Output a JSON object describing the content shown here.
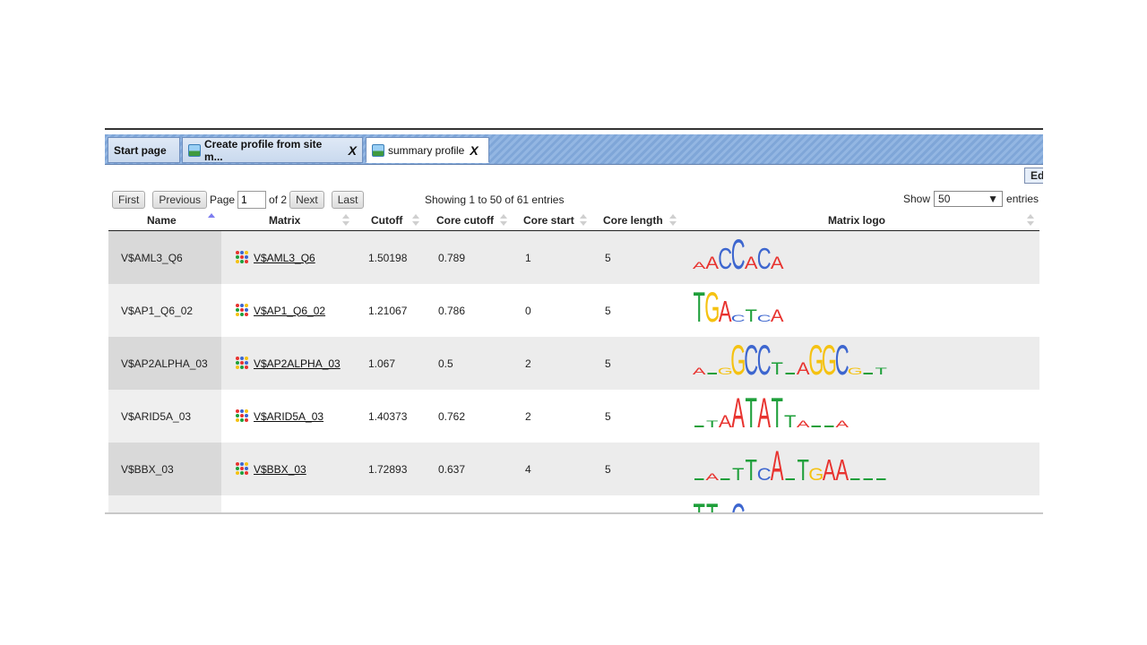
{
  "tabs": [
    {
      "label": "Start page",
      "has_icon": false,
      "closable": false
    },
    {
      "label": "Create profile from site m...",
      "has_icon": true,
      "closable": true
    },
    {
      "label": "summary profile",
      "has_icon": true,
      "closable": true,
      "active": true
    }
  ],
  "close_glyph": "X",
  "edit_button": "Ed",
  "pager": {
    "first": "First",
    "previous": "Previous",
    "page_label": "Page",
    "page_value": "1",
    "of_label": "of 2",
    "next": "Next",
    "last": "Last"
  },
  "info": "Showing 1 to 50 of 61 entries",
  "show": {
    "label": "Show",
    "value": "50",
    "suffix": "entries"
  },
  "columns": {
    "name": "Name",
    "matrix": "Matrix",
    "cutoff": "Cutoff",
    "core_cutoff": "Core cutoff",
    "core_start": "Core start",
    "core_length": "Core length",
    "matrix_logo": "Matrix logo"
  },
  "rows": [
    {
      "name": "V$AML3_Q6",
      "matrix": "V$AML3_Q6",
      "cutoff": "1.50198",
      "core_cutoff": "0.789",
      "core_start": "1",
      "core_length": "5",
      "logo": [
        [
          "A",
          "s"
        ],
        [
          "A",
          "m"
        ],
        [
          "C",
          "l"
        ],
        [
          "C",
          "xl"
        ],
        [
          "A",
          "m"
        ],
        [
          "C",
          "l"
        ],
        [
          "A",
          "m"
        ]
      ]
    },
    {
      "name": "V$AP1_Q6_02",
      "matrix": "V$AP1_Q6_02",
      "cutoff": "1.21067",
      "core_cutoff": "0.786",
      "core_start": "0",
      "core_length": "5",
      "logo": [
        [
          "T",
          "xl"
        ],
        [
          "G",
          "xl"
        ],
        [
          "A",
          "l"
        ],
        [
          "C",
          "s"
        ],
        [
          "T",
          "m"
        ],
        [
          "C",
          "s"
        ],
        [
          "A",
          "m"
        ]
      ]
    },
    {
      "name": "V$AP2ALPHA_03",
      "matrix": "V$AP2ALPHA_03",
      "cutoff": "1.067",
      "core_cutoff": "0.5",
      "core_start": "2",
      "core_length": "5",
      "logo": [
        [
          "A",
          "s"
        ],
        [
          "_",
          "s"
        ],
        [
          "G",
          "s"
        ],
        [
          "G",
          "xl"
        ],
        [
          "C",
          "xl"
        ],
        [
          "C",
          "xl"
        ],
        [
          "T",
          "m"
        ],
        [
          "_",
          "s"
        ],
        [
          "A",
          "m"
        ],
        [
          "G",
          "xl"
        ],
        [
          "G",
          "xl"
        ],
        [
          "C",
          "xl"
        ],
        [
          "G",
          "s"
        ],
        [
          "_",
          "s"
        ],
        [
          "T",
          "s"
        ]
      ]
    },
    {
      "name": "V$ARID5A_03",
      "matrix": "V$ARID5A_03",
      "cutoff": "1.40373",
      "core_cutoff": "0.762",
      "core_start": "2",
      "core_length": "5",
      "logo": [
        [
          "_",
          "s"
        ],
        [
          "T",
          "s"
        ],
        [
          "A",
          "m"
        ],
        [
          "A",
          "xl"
        ],
        [
          "T",
          "xl"
        ],
        [
          "A",
          "xl"
        ],
        [
          "T",
          "xl"
        ],
        [
          "T",
          "m"
        ],
        [
          "A",
          "s"
        ],
        [
          "_",
          "s"
        ],
        [
          "_",
          "s"
        ],
        [
          "A",
          "s"
        ]
      ]
    },
    {
      "name": "V$BBX_03",
      "matrix": "V$BBX_03",
      "cutoff": "1.72893",
      "core_cutoff": "0.637",
      "core_start": "4",
      "core_length": "5",
      "logo": [
        [
          "_",
          "s"
        ],
        [
          "A",
          "s"
        ],
        [
          "_",
          "s"
        ],
        [
          "T",
          "m"
        ],
        [
          "T",
          "l"
        ],
        [
          "C",
          "m"
        ],
        [
          "A",
          "xl"
        ],
        [
          "_",
          "s"
        ],
        [
          "T",
          "l"
        ],
        [
          "G",
          "m"
        ],
        [
          "A",
          "l"
        ],
        [
          "A",
          "l"
        ],
        [
          "_",
          "s"
        ],
        [
          "_",
          "s"
        ],
        [
          "_",
          "s"
        ]
      ]
    },
    {
      "name": "",
      "matrix": "",
      "cutoff": "",
      "core_cutoff": "",
      "core_start": "",
      "core_length": "",
      "logo": [
        [
          "T",
          "xl"
        ],
        [
          "T",
          "xl"
        ],
        [
          "_",
          "s"
        ],
        [
          "C",
          "xl"
        ]
      ]
    }
  ],
  "colors": {
    "A": "#e8332f",
    "C": "#3d66cf",
    "G": "#f5c211",
    "T": "#1e9f3a",
    "_": "#1e9f3a"
  },
  "matrix_icon_colors": [
    "#e8332f",
    "#3d66cf",
    "#f5c211",
    "#1e9f3a",
    "#e8332f",
    "#3d66cf",
    "#f5c211",
    "#1e9f3a",
    "#e8332f"
  ]
}
